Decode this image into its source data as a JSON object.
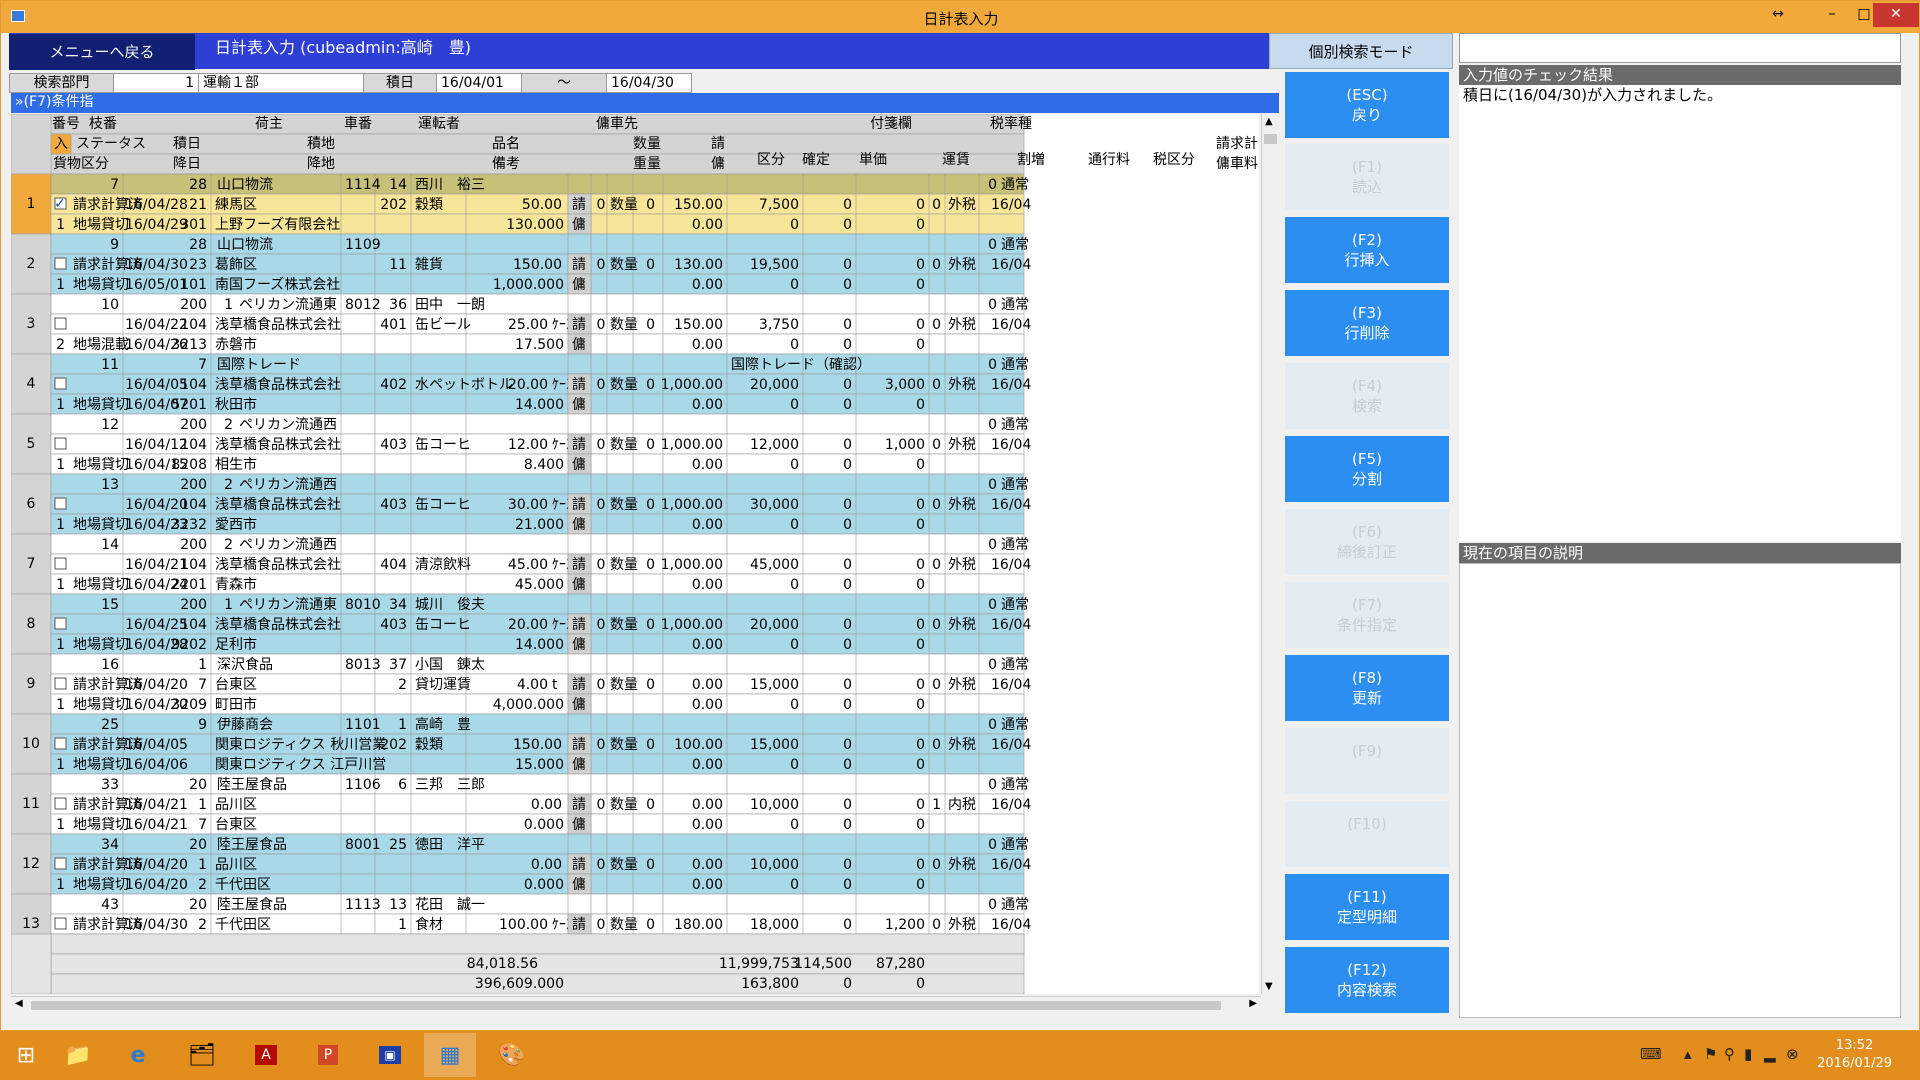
{
  "window": {
    "title": "日計表入力",
    "min": "–",
    "max": "□",
    "close": "✕",
    "resize": "↔"
  },
  "header": {
    "menu_button": "メニューへ戻る",
    "app_title": "日計表入力 (cubeadmin:高崎　豊)",
    "mode_button": "個別検索モード"
  },
  "search": {
    "dept_label": "検索部門",
    "dept_code": "1",
    "dept_name": "運輸１部",
    "date_label": "積日",
    "date_from": "16/04/01",
    "tilde": "～",
    "date_to": "16/04/30"
  },
  "condition_bar": "»(F7)条件指",
  "columns": {
    "r1": [
      "番号",
      "枝番",
      "荷主",
      "車番",
      "運転者",
      "傭車先",
      "付箋欄",
      "税率種"
    ],
    "r2": [
      "入",
      "ステータス",
      "積日",
      "積地",
      "品名",
      "数量",
      "請",
      "区分",
      "確定",
      "単価",
      "運賃",
      "割増",
      "通行料",
      "税区分",
      "請求計"
    ],
    "r3": [
      "貨物区分",
      "降日",
      "降地",
      "備考",
      "重量",
      "傭",
      "傭車料"
    ]
  },
  "rows": [
    {
      "no": "1",
      "num": "7",
      "branch": "28",
      "shipper": "山口物流",
      "car": "1114",
      "dcode": "14",
      "driver": "西川　裕三",
      "checked": true,
      "status": "請求計算済",
      "ldate": "16/04/28",
      "lcode": "21",
      "lplace": "練馬区",
      "icode": "202",
      "item": "穀類",
      "qty": "50.00",
      "unit": "",
      "kubun": "0",
      "kname": "数量",
      "kakutei": "0",
      "price": "150.00",
      "fare": "7,500",
      "warimashi": "0",
      "toll": "0",
      "taxc": "0",
      "taxname": "外税",
      "bill": "16/04",
      "fcode": "1",
      "fname": "地場貸切",
      "udate": "16/04/29",
      "ucode": "301",
      "uplace": "上野フーズ有限会社",
      "biko": "",
      "weight": "130.000",
      "hprice": "0.00",
      "hfare": "0",
      "hwari": "0",
      "htoll": "0",
      "memo": "",
      "tax": "0",
      "taxtype": "通常"
    },
    {
      "no": "2",
      "num": "9",
      "branch": "28",
      "shipper": "山口物流",
      "car": "1109",
      "dcode": "",
      "driver": "",
      "checked": false,
      "status": "請求計算済",
      "ldate": "16/04/30",
      "lcode": "23",
      "lplace": "葛飾区",
      "icode": "11",
      "item": "雑貨",
      "qty": "150.00",
      "unit": "",
      "kubun": "0",
      "kname": "数量",
      "kakutei": "0",
      "price": "130.00",
      "fare": "19,500",
      "warimashi": "0",
      "toll": "0",
      "taxc": "0",
      "taxname": "外税",
      "bill": "16/04",
      "fcode": "1",
      "fname": "地場貸切",
      "udate": "16/05/01",
      "ucode": "101",
      "uplace": "南国フーズ株式会社",
      "biko": "",
      "weight": "1,000.000",
      "hprice": "0.00",
      "hfare": "0",
      "hwari": "0",
      "htoll": "0",
      "memo": "",
      "tax": "0",
      "taxtype": "通常"
    },
    {
      "no": "3",
      "num": "10",
      "branch": "200",
      "shipper": "ペリカン流通東",
      "scode": "1",
      "car": "8012",
      "dcode": "36",
      "driver": "田中　一朗",
      "checked": false,
      "status": "",
      "ldate": "16/04/22",
      "lcode": "104",
      "lplace": "浅草橋食品株式会社",
      "icode": "401",
      "item": "缶ビール",
      "qty": "25.00",
      "unit": "ｹｰｽ",
      "kubun": "0",
      "kname": "数量",
      "kakutei": "0",
      "price": "150.00",
      "fare": "3,750",
      "warimashi": "0",
      "toll": "0",
      "taxc": "0",
      "taxname": "外税",
      "bill": "16/04",
      "fcode": "2",
      "fname": "地場混載",
      "udate": "16/04/26",
      "ucode": "3213",
      "uplace": "赤磐市",
      "biko": "",
      "weight": "17.500",
      "hprice": "0.00",
      "hfare": "0",
      "hwari": "0",
      "htoll": "0",
      "memo": "",
      "tax": "0",
      "taxtype": "通常"
    },
    {
      "no": "4",
      "num": "11",
      "branch": "7",
      "shipper": "国際トレード",
      "car": "",
      "dcode": "",
      "driver": "",
      "checked": false,
      "status": "",
      "ldate": "16/04/05",
      "lcode": "104",
      "lplace": "浅草橋食品株式会社",
      "icode": "402",
      "item": "水ペットボトル",
      "qty": "20.00",
      "unit": "ｹｰｽ",
      "kubun": "0",
      "kname": "数量",
      "kakutei": "0",
      "price": "1,000.00",
      "fare": "20,000",
      "warimashi": "0",
      "toll": "3,000",
      "taxc": "0",
      "taxname": "外税",
      "bill": "16/04",
      "fcode": "1",
      "fname": "地場貸切",
      "udate": "16/04/07",
      "ucode": "5201",
      "uplace": "秋田市",
      "biko": "",
      "weight": "14.000",
      "hprice": "0.00",
      "hfare": "0",
      "hwari": "0",
      "htoll": "0",
      "memo": "国際トレード（確認）",
      "tax": "0",
      "taxtype": "通常"
    },
    {
      "no": "5",
      "num": "12",
      "branch": "200",
      "shipper": "ペリカン流通西",
      "scode": "2",
      "car": "",
      "dcode": "",
      "driver": "",
      "checked": false,
      "status": "",
      "ldate": "16/04/12",
      "lcode": "104",
      "lplace": "浅草橋食品株式会社",
      "icode": "403",
      "item": "缶コーヒ",
      "qty": "12.00",
      "unit": "ｹｰｽ",
      "kubun": "0",
      "kname": "数量",
      "kakutei": "0",
      "price": "1,000.00",
      "fare": "12,000",
      "warimashi": "0",
      "toll": "1,000",
      "taxc": "0",
      "taxname": "外税",
      "bill": "16/04",
      "fcode": "1",
      "fname": "地場貸切",
      "udate": "16/04/15",
      "ucode": "8208",
      "uplace": "相生市",
      "biko": "",
      "weight": "8.400",
      "hprice": "0.00",
      "hfare": "0",
      "hwari": "0",
      "htoll": "0",
      "memo": "",
      "tax": "0",
      "taxtype": "通常"
    },
    {
      "no": "6",
      "num": "13",
      "branch": "200",
      "shipper": "ペリカン流通西",
      "scode": "2",
      "car": "",
      "dcode": "",
      "driver": "",
      "checked": false,
      "status": "",
      "ldate": "16/04/20",
      "lcode": "104",
      "lplace": "浅草橋食品株式会社",
      "icode": "403",
      "item": "缶コーヒ",
      "qty": "30.00",
      "unit": "ｹｰｽ",
      "kubun": "0",
      "kname": "数量",
      "kakutei": "0",
      "price": "1,000.00",
      "fare": "30,000",
      "warimashi": "0",
      "toll": "0",
      "taxc": "0",
      "taxname": "外税",
      "bill": "16/04",
      "fcode": "1",
      "fname": "地場貸切",
      "udate": "16/04/23",
      "ucode": "3232",
      "uplace": "愛西市",
      "biko": "",
      "weight": "21.000",
      "hprice": "0.00",
      "hfare": "0",
      "hwari": "0",
      "htoll": "0",
      "memo": "",
      "tax": "0",
      "taxtype": "通常"
    },
    {
      "no": "7",
      "num": "14",
      "branch": "200",
      "shipper": "ペリカン流通西",
      "scode": "2",
      "car": "",
      "dcode": "",
      "driver": "",
      "checked": false,
      "status": "",
      "ldate": "16/04/21",
      "lcode": "104",
      "lplace": "浅草橋食品株式会社",
      "icode": "404",
      "item": "清涼飲料",
      "qty": "45.00",
      "unit": "ｹｰｽ",
      "kubun": "0",
      "kname": "数量",
      "kakutei": "0",
      "price": "1,000.00",
      "fare": "45,000",
      "warimashi": "0",
      "toll": "0",
      "taxc": "0",
      "taxname": "外税",
      "bill": "16/04",
      "fcode": "1",
      "fname": "地場貸切",
      "udate": "16/04/24",
      "ucode": "2201",
      "uplace": "青森市",
      "biko": "",
      "weight": "45.000",
      "hprice": "0.00",
      "hfare": "0",
      "hwari": "0",
      "htoll": "0",
      "memo": "",
      "tax": "0",
      "taxtype": "通常"
    },
    {
      "no": "8",
      "num": "15",
      "branch": "200",
      "shipper": "ペリカン流通東",
      "scode": "1",
      "car": "8010",
      "dcode": "34",
      "driver": "城川　俊夫",
      "checked": false,
      "status": "",
      "ldate": "16/04/25",
      "lcode": "104",
      "lplace": "浅草橋食品株式会社",
      "icode": "403",
      "item": "缶コーヒ",
      "qty": "20.00",
      "unit": "ｹｰｽ",
      "kubun": "0",
      "kname": "数量",
      "kakutei": "0",
      "price": "1,000.00",
      "fare": "20,000",
      "warimashi": "0",
      "toll": "0",
      "taxc": "0",
      "taxname": "外税",
      "bill": "16/04",
      "fcode": "1",
      "fname": "地場貸切",
      "udate": "16/04/28",
      "ucode": "9202",
      "uplace": "足利市",
      "biko": "",
      "weight": "14.000",
      "hprice": "0.00",
      "hfare": "0",
      "hwari": "0",
      "htoll": "0",
      "memo": "",
      "tax": "0",
      "taxtype": "通常"
    },
    {
      "no": "9",
      "num": "16",
      "branch": "1",
      "shipper": "深沢食品",
      "car": "8013",
      "dcode": "37",
      "driver": "小国　錬太",
      "checked": false,
      "status": "請求計算済",
      "ldate": "16/04/20",
      "lcode": "7",
      "lplace": "台東区",
      "icode": "2",
      "item": "貸切運賃",
      "qty": "4.00",
      "unit": "t",
      "kubun": "0",
      "kname": "数量",
      "kakutei": "0",
      "price": "0.00",
      "fare": "15,000",
      "warimashi": "0",
      "toll": "0",
      "taxc": "0",
      "taxname": "外税",
      "bill": "16/04",
      "fcode": "1",
      "fname": "地場貸切",
      "udate": "16/04/20",
      "ucode": "3209",
      "uplace": "町田市",
      "biko": "",
      "weight": "4,000.000",
      "hprice": "0.00",
      "hfare": "0",
      "hwari": "0",
      "htoll": "0",
      "memo": "",
      "tax": "0",
      "taxtype": "通常"
    },
    {
      "no": "10",
      "num": "25",
      "branch": "9",
      "shipper": "伊藤商会",
      "car": "1101",
      "dcode": "1",
      "driver": "高崎　豊",
      "checked": false,
      "status": "請求計算済",
      "ldate": "16/04/05",
      "lcode": "",
      "lplace": "関東ロジティクス 秋川営業",
      "icode": "202",
      "item": "穀類",
      "qty": "150.00",
      "unit": "",
      "kubun": "0",
      "kname": "数量",
      "kakutei": "0",
      "price": "100.00",
      "fare": "15,000",
      "warimashi": "0",
      "toll": "0",
      "taxc": "0",
      "taxname": "外税",
      "bill": "16/04",
      "fcode": "1",
      "fname": "地場貸切",
      "udate": "16/04/06",
      "ucode": "",
      "uplace": "関東ロジティクス 江戸川営",
      "biko": "",
      "weight": "15.000",
      "hprice": "0.00",
      "hfare": "0",
      "hwari": "0",
      "htoll": "0",
      "memo": "",
      "tax": "0",
      "taxtype": "通常"
    },
    {
      "no": "11",
      "num": "33",
      "branch": "20",
      "shipper": "陸王屋食品",
      "car": "1106",
      "dcode": "6",
      "driver": "三邦　三郎",
      "checked": false,
      "status": "請求計算済",
      "ldate": "16/04/21",
      "lcode": "1",
      "lplace": "品川区",
      "icode": "",
      "item": "",
      "qty": "0.00",
      "unit": "",
      "kubun": "0",
      "kname": "数量",
      "kakutei": "0",
      "price": "0.00",
      "fare": "10,000",
      "warimashi": "0",
      "toll": "0",
      "taxc": "1",
      "taxname": "内税",
      "bill": "16/04",
      "fcode": "1",
      "fname": "地場貸切",
      "udate": "16/04/21",
      "ucode": "7",
      "uplace": "台東区",
      "biko": "",
      "weight": "0.000",
      "hprice": "0.00",
      "hfare": "0",
      "hwari": "0",
      "htoll": "0",
      "memo": "",
      "tax": "0",
      "taxtype": "通常"
    },
    {
      "no": "12",
      "num": "34",
      "branch": "20",
      "shipper": "陸王屋食品",
      "car": "8001",
      "dcode": "25",
      "driver": "徳田　洋平",
      "checked": false,
      "status": "請求計算済",
      "ldate": "16/04/20",
      "lcode": "1",
      "lplace": "品川区",
      "icode": "",
      "item": "",
      "qty": "0.00",
      "unit": "",
      "kubun": "0",
      "kname": "数量",
      "kakutei": "0",
      "price": "0.00",
      "fare": "10,000",
      "warimashi": "0",
      "toll": "0",
      "taxc": "0",
      "taxname": "外税",
      "bill": "16/04",
      "fcode": "1",
      "fname": "地場貸切",
      "udate": "16/04/20",
      "ucode": "2",
      "uplace": "千代田区",
      "biko": "",
      "weight": "0.000",
      "hprice": "0.00",
      "hfare": "0",
      "hwari": "0",
      "htoll": "0",
      "memo": "",
      "tax": "0",
      "taxtype": "通常"
    },
    {
      "no": "13",
      "num": "43",
      "branch": "20",
      "shipper": "陸王屋食品",
      "car": "1113",
      "dcode": "13",
      "driver": "花田　誠一",
      "checked": false,
      "status": "請求計算済",
      "ldate": "16/04/30",
      "lcode": "2",
      "lplace": "千代田区",
      "icode": "1",
      "item": "食材",
      "qty": "100.00",
      "unit": "ｹｰｽ",
      "kubun": "0",
      "kname": "数量",
      "kakutei": "0",
      "price": "180.00",
      "fare": "18,000",
      "warimashi": "0",
      "toll": "1,200",
      "taxc": "0",
      "taxname": "外税",
      "bill": "16/04",
      "fcode": "",
      "fname": "",
      "udate": "",
      "ucode": "",
      "uplace": "",
      "biko": "",
      "weight": "",
      "hprice": "",
      "hfare": "",
      "hwari": "",
      "htoll": "",
      "memo": "",
      "tax": "0",
      "taxtype": "通常"
    }
  ],
  "totals": {
    "qty": "84,018.56",
    "fare": "11,999,753",
    "warimashi": "114,500",
    "toll": "87,280",
    "weight": "396,609.000",
    "hfare": "163,800",
    "hwari": "0",
    "htoll": "0"
  },
  "fkeys": [
    {
      "key": "(ESC)",
      "label": "戻り",
      "enabled": true
    },
    {
      "key": "(F1)",
      "label": "読込",
      "enabled": false
    },
    {
      "key": "(F2)",
      "label": "行挿入",
      "enabled": true
    },
    {
      "key": "(F3)",
      "label": "行削除",
      "enabled": true
    },
    {
      "key": "(F4)",
      "label": "検索",
      "enabled": false
    },
    {
      "key": "(F5)",
      "label": "分割",
      "enabled": true
    },
    {
      "key": "(F6)",
      "label": "締後訂正",
      "enabled": false
    },
    {
      "key": "(F7)",
      "label": "条件指定",
      "enabled": false
    },
    {
      "key": "(F8)",
      "label": "更新",
      "enabled": true
    },
    {
      "key": "(F9)",
      "label": "",
      "enabled": false
    },
    {
      "key": "(F10)",
      "label": "",
      "enabled": false
    },
    {
      "key": "(F11)",
      "label": "定型明細",
      "enabled": true
    },
    {
      "key": "(F12)",
      "label": "内容検索",
      "enabled": true
    }
  ],
  "right_panel": {
    "check_header": "入力値のチェック結果",
    "check_message": "積日に(16/04/30)が入力されました。",
    "desc_header": "現在の項目の説明"
  },
  "colors": {
    "title_bar": "#f2a93b",
    "blue_bar": "#2d3fd4",
    "fkey_on": "#2c8ef0",
    "row_selected": "#f7e59a",
    "row_alt": "#a9d8e8"
  },
  "taskbar": {
    "time": "13:52",
    "date": "2016/01/29",
    "icons": [
      "start-icon",
      "explorer-icon",
      "ie-icon",
      "folder-icon",
      "pdf-icon",
      "powerpoint-icon",
      "app-icon",
      "active-app-icon",
      "paint-icon"
    ]
  }
}
